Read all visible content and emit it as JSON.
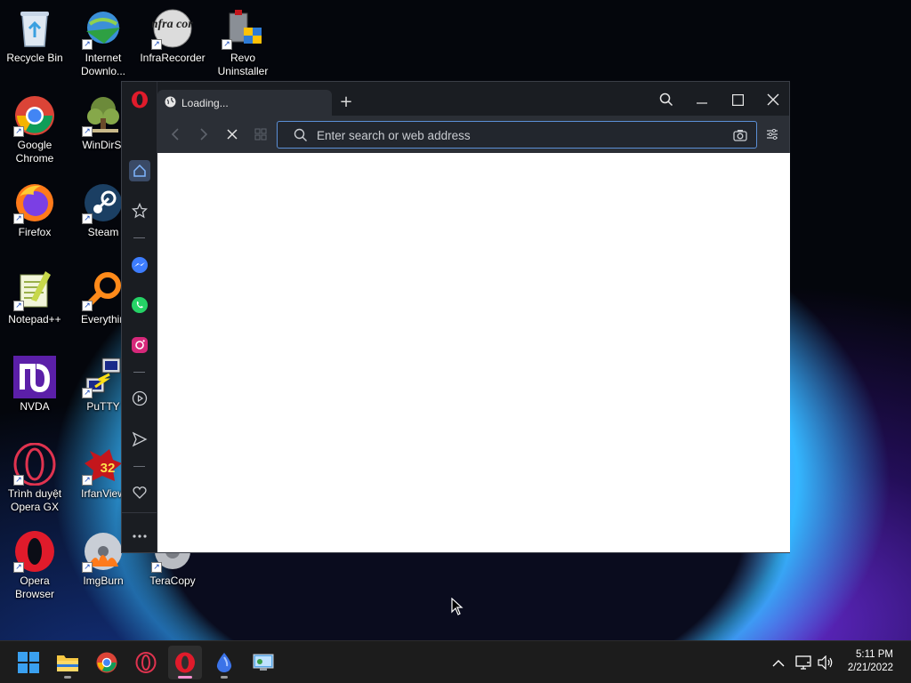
{
  "desktop": {
    "icons": [
      {
        "label": "Recycle Bin",
        "icon": "recycle-bin-icon"
      },
      {
        "label": "Internet Downlo...",
        "icon": "internet-download-manager-icon"
      },
      {
        "label": "InfraRecorder",
        "icon": "infrarecorder-icon",
        "art_text": "Infra cord"
      },
      {
        "label": "Revo Uninstaller",
        "icon": "revo-uninstaller-icon"
      },
      {
        "label": "Google Chrome",
        "icon": "chrome-icon"
      },
      {
        "label": "WinDirSt",
        "icon": "windirstat-icon"
      },
      {
        "label": "Firefox",
        "icon": "firefox-icon"
      },
      {
        "label": "Steam",
        "icon": "steam-icon"
      },
      {
        "label": "Notepad++",
        "icon": "notepad-plus-plus-icon"
      },
      {
        "label": "Everythin",
        "icon": "everything-search-icon"
      },
      {
        "label": "NVDA",
        "icon": "nvda-icon"
      },
      {
        "label": "PuTTY",
        "icon": "putty-icon"
      },
      {
        "label": "Trình duyệt Opera GX",
        "icon": "opera-gx-icon"
      },
      {
        "label": "IrfanView",
        "icon": "irfanview-icon",
        "badge": "32"
      },
      {
        "label": "Opera Browser",
        "icon": "opera-icon"
      },
      {
        "label": "ImgBurn",
        "icon": "imgburn-icon"
      },
      {
        "label": "TeraCopy",
        "icon": "teracopy-icon"
      }
    ]
  },
  "browser": {
    "tab_title": "Loading...",
    "new_tab_symbol": "+",
    "address_placeholder": "Enter search or web address",
    "sidebar_items": [
      "home",
      "bookmarks",
      "messenger",
      "whatsapp",
      "instagram",
      "player",
      "send",
      "pinboards",
      "more"
    ],
    "colors": {
      "frame": "#1f2228",
      "toolbar": "#2b2f36",
      "accent": "#5b8fd6",
      "content": "#ffffff"
    }
  },
  "taskbar": {
    "apps": [
      "start",
      "file-explorer",
      "chrome",
      "opera-gx",
      "opera",
      "app-blue-drop",
      "control-panel"
    ],
    "active_app": "opera",
    "clock_time": "5:11 PM",
    "clock_date": "2/21/2022",
    "accent_color": "#f48fcf"
  }
}
